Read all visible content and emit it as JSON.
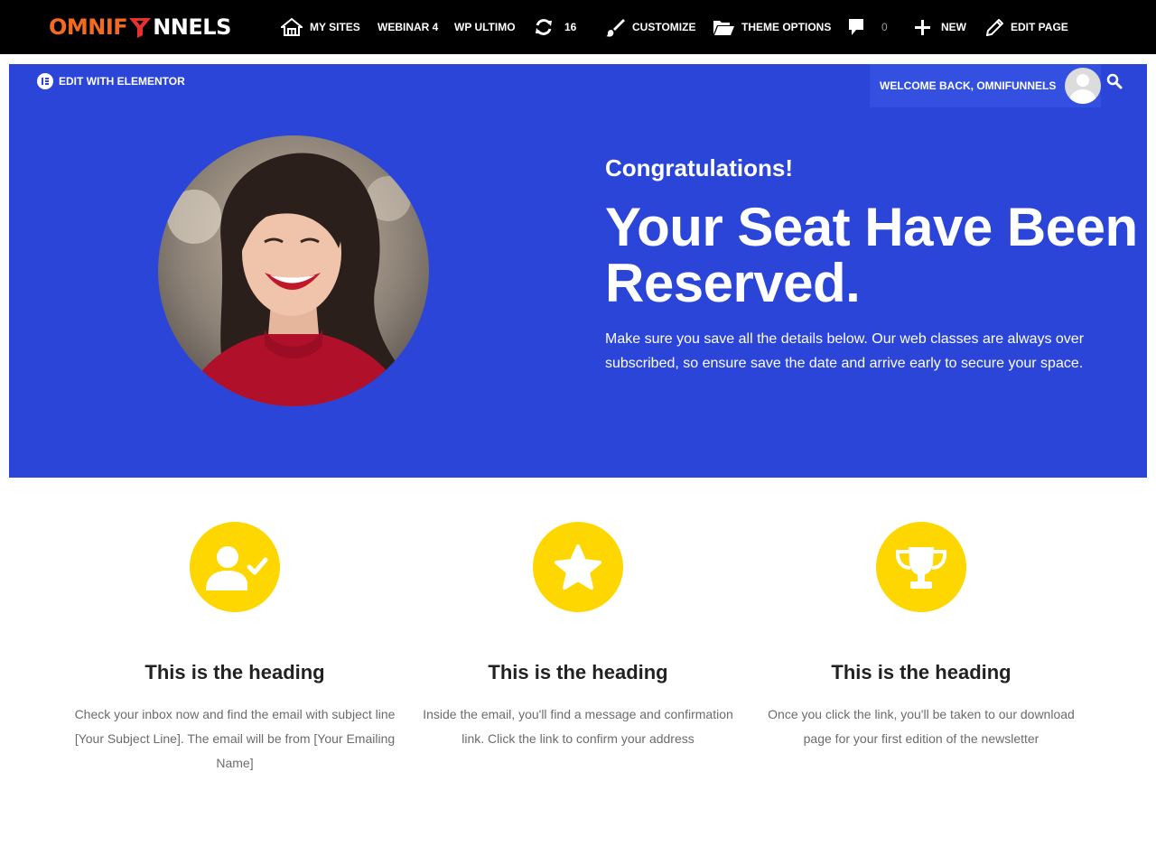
{
  "adminbar": {
    "logo_part1": "OMNIF",
    "logo_part2": "NNELS",
    "my_sites": "MY SITES",
    "webinar": "WEBINAR 4",
    "wp_ultimo": "WP ULTIMO",
    "updates_count": "16",
    "customize": "CUSTOMIZE",
    "theme_options": "THEME OPTIONS",
    "comments_count": "0",
    "new": "NEW",
    "edit_page": "EDIT PAGE"
  },
  "hero": {
    "edit_with_elementor": "EDIT WITH ELEMENTOR",
    "welcome_text": "WELCOME BACK, OMNIFUNNELS",
    "congrats": "Congratulations!",
    "headline": "Your Seat Have Been Reserved.",
    "subcopy": "Make sure you save all the details below. Our web classes are always over subscribed, so ensure save the date and arrive early to secure your space."
  },
  "features": [
    {
      "icon": "user-check-icon",
      "heading": "This is the heading",
      "text": "Check your inbox now and find the email with subject line [Your Subject Line]. The email will be from [Your Emailing Name]"
    },
    {
      "icon": "star-icon",
      "heading": "This is the heading",
      "text": "Inside the email, you'll find a message and confirmation link. Click the link to confirm your address"
    },
    {
      "icon": "trophy-icon",
      "heading": "This is the heading",
      "text": "Once you click the link, you'll be taken to our download page for your first edition of the newsletter"
    }
  ],
  "colors": {
    "hero_bg": "#2b45d8",
    "accent_yellow": "#ffd700",
    "logo_orange": "#f26b21",
    "adminbar_bg": "#000000"
  }
}
